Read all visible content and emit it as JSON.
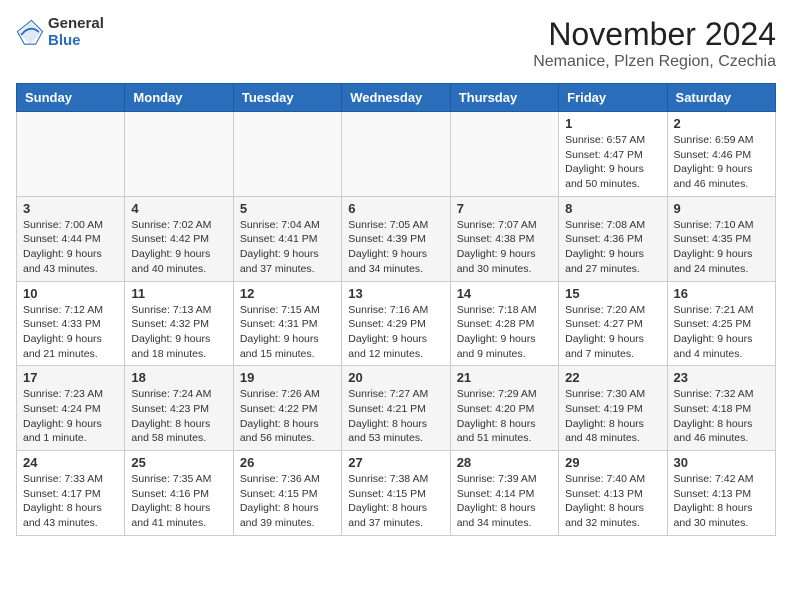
{
  "header": {
    "logo_general": "General",
    "logo_blue": "Blue",
    "month_title": "November 2024",
    "location": "Nemanice, Plzen Region, Czechia"
  },
  "days_of_week": [
    "Sunday",
    "Monday",
    "Tuesday",
    "Wednesday",
    "Thursday",
    "Friday",
    "Saturday"
  ],
  "weeks": [
    [
      {
        "day": "",
        "info": ""
      },
      {
        "day": "",
        "info": ""
      },
      {
        "day": "",
        "info": ""
      },
      {
        "day": "",
        "info": ""
      },
      {
        "day": "",
        "info": ""
      },
      {
        "day": "1",
        "info": "Sunrise: 6:57 AM\nSunset: 4:47 PM\nDaylight: 9 hours\nand 50 minutes."
      },
      {
        "day": "2",
        "info": "Sunrise: 6:59 AM\nSunset: 4:46 PM\nDaylight: 9 hours\nand 46 minutes."
      }
    ],
    [
      {
        "day": "3",
        "info": "Sunrise: 7:00 AM\nSunset: 4:44 PM\nDaylight: 9 hours\nand 43 minutes."
      },
      {
        "day": "4",
        "info": "Sunrise: 7:02 AM\nSunset: 4:42 PM\nDaylight: 9 hours\nand 40 minutes."
      },
      {
        "day": "5",
        "info": "Sunrise: 7:04 AM\nSunset: 4:41 PM\nDaylight: 9 hours\nand 37 minutes."
      },
      {
        "day": "6",
        "info": "Sunrise: 7:05 AM\nSunset: 4:39 PM\nDaylight: 9 hours\nand 34 minutes."
      },
      {
        "day": "7",
        "info": "Sunrise: 7:07 AM\nSunset: 4:38 PM\nDaylight: 9 hours\nand 30 minutes."
      },
      {
        "day": "8",
        "info": "Sunrise: 7:08 AM\nSunset: 4:36 PM\nDaylight: 9 hours\nand 27 minutes."
      },
      {
        "day": "9",
        "info": "Sunrise: 7:10 AM\nSunset: 4:35 PM\nDaylight: 9 hours\nand 24 minutes."
      }
    ],
    [
      {
        "day": "10",
        "info": "Sunrise: 7:12 AM\nSunset: 4:33 PM\nDaylight: 9 hours\nand 21 minutes."
      },
      {
        "day": "11",
        "info": "Sunrise: 7:13 AM\nSunset: 4:32 PM\nDaylight: 9 hours\nand 18 minutes."
      },
      {
        "day": "12",
        "info": "Sunrise: 7:15 AM\nSunset: 4:31 PM\nDaylight: 9 hours\nand 15 minutes."
      },
      {
        "day": "13",
        "info": "Sunrise: 7:16 AM\nSunset: 4:29 PM\nDaylight: 9 hours\nand 12 minutes."
      },
      {
        "day": "14",
        "info": "Sunrise: 7:18 AM\nSunset: 4:28 PM\nDaylight: 9 hours\nand 9 minutes."
      },
      {
        "day": "15",
        "info": "Sunrise: 7:20 AM\nSunset: 4:27 PM\nDaylight: 9 hours\nand 7 minutes."
      },
      {
        "day": "16",
        "info": "Sunrise: 7:21 AM\nSunset: 4:25 PM\nDaylight: 9 hours\nand 4 minutes."
      }
    ],
    [
      {
        "day": "17",
        "info": "Sunrise: 7:23 AM\nSunset: 4:24 PM\nDaylight: 9 hours\nand 1 minute."
      },
      {
        "day": "18",
        "info": "Sunrise: 7:24 AM\nSunset: 4:23 PM\nDaylight: 8 hours\nand 58 minutes."
      },
      {
        "day": "19",
        "info": "Sunrise: 7:26 AM\nSunset: 4:22 PM\nDaylight: 8 hours\nand 56 minutes."
      },
      {
        "day": "20",
        "info": "Sunrise: 7:27 AM\nSunset: 4:21 PM\nDaylight: 8 hours\nand 53 minutes."
      },
      {
        "day": "21",
        "info": "Sunrise: 7:29 AM\nSunset: 4:20 PM\nDaylight: 8 hours\nand 51 minutes."
      },
      {
        "day": "22",
        "info": "Sunrise: 7:30 AM\nSunset: 4:19 PM\nDaylight: 8 hours\nand 48 minutes."
      },
      {
        "day": "23",
        "info": "Sunrise: 7:32 AM\nSunset: 4:18 PM\nDaylight: 8 hours\nand 46 minutes."
      }
    ],
    [
      {
        "day": "24",
        "info": "Sunrise: 7:33 AM\nSunset: 4:17 PM\nDaylight: 8 hours\nand 43 minutes."
      },
      {
        "day": "25",
        "info": "Sunrise: 7:35 AM\nSunset: 4:16 PM\nDaylight: 8 hours\nand 41 minutes."
      },
      {
        "day": "26",
        "info": "Sunrise: 7:36 AM\nSunset: 4:15 PM\nDaylight: 8 hours\nand 39 minutes."
      },
      {
        "day": "27",
        "info": "Sunrise: 7:38 AM\nSunset: 4:15 PM\nDaylight: 8 hours\nand 37 minutes."
      },
      {
        "day": "28",
        "info": "Sunrise: 7:39 AM\nSunset: 4:14 PM\nDaylight: 8 hours\nand 34 minutes."
      },
      {
        "day": "29",
        "info": "Sunrise: 7:40 AM\nSunset: 4:13 PM\nDaylight: 8 hours\nand 32 minutes."
      },
      {
        "day": "30",
        "info": "Sunrise: 7:42 AM\nSunset: 4:13 PM\nDaylight: 8 hours\nand 30 minutes."
      }
    ]
  ]
}
